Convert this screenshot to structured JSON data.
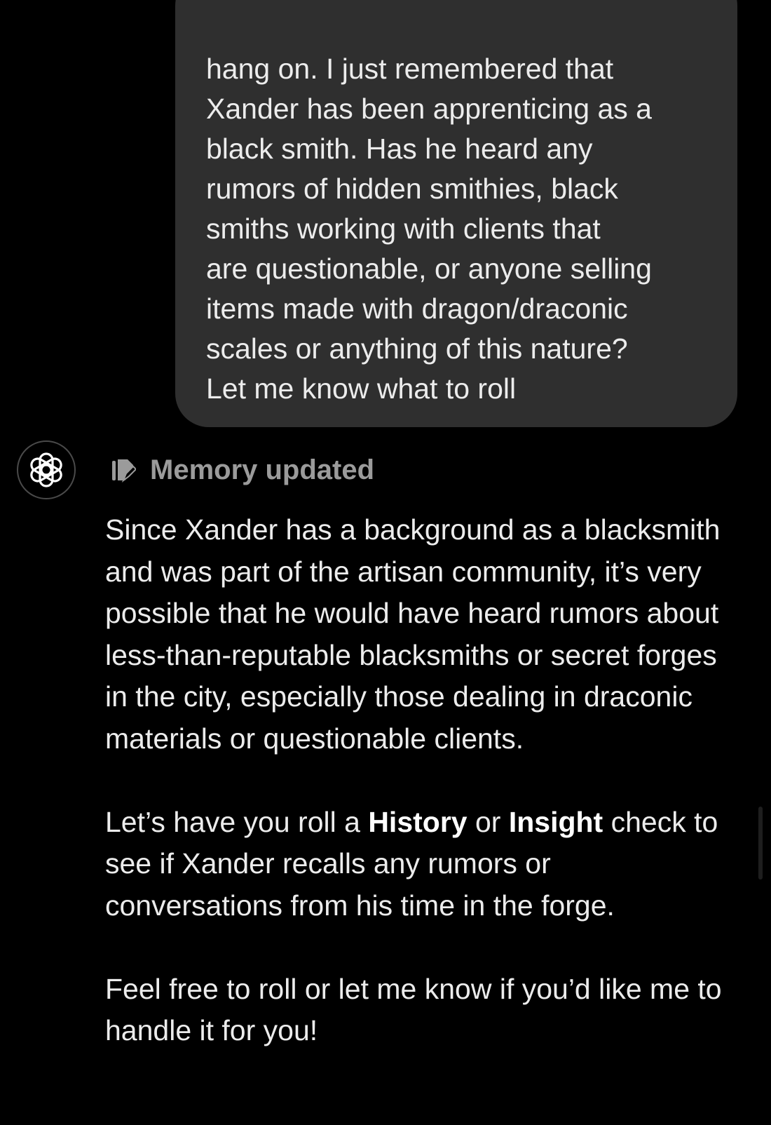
{
  "user_message": {
    "text": "hang on. I just remembered that\nXander has been apprenticing as a\nblack smith. Has he heard any\nrumors of hidden smithies, black\nsmiths working with clients that\nare questionable, or anyone selling\nitems made with dragon/draconic\nscales or anything of this nature?\nLet me know what to roll"
  },
  "assistant": {
    "avatar_icon": "openai-logo-icon",
    "memory_status": {
      "icon": "memory-edit-icon",
      "label": "Memory updated"
    },
    "paragraph_1": "Since Xander has a background as a blacksmith and was part of the artisan community, it’s very possible that he would have heard rumors about less-than-reputable blacksmiths or secret forges in the city, especially those dealing in draconic materials or questionable clients.",
    "paragraph_2": {
      "prefix": "Let’s have you roll a ",
      "bold_1": "History",
      "middle": " or ",
      "bold_2": "Insight",
      "suffix": " check to see if Xander recalls any rumors or conversations from his time in the forge."
    },
    "paragraph_3": "Feel free to roll or let me know if you’d like me to handle it for you!"
  },
  "colors": {
    "background": "#000000",
    "user_bubble": "#2f2f2f",
    "text": "#ececec",
    "muted": "#9b9b9b"
  }
}
